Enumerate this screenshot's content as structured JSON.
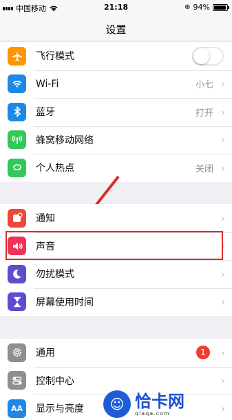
{
  "status_bar": {
    "carrier": "中国移动",
    "time": "21:18",
    "battery": "94%",
    "battery_level": 0.94
  },
  "nav": {
    "title": "设置"
  },
  "groups": [
    {
      "rows": [
        {
          "label": "飞行模式",
          "icon": "airplane-icon",
          "color": "#ff9500",
          "toggle": false
        },
        {
          "label": "Wi-Fi",
          "icon": "wifi-icon",
          "color": "#1e88e5",
          "value": "小七"
        },
        {
          "label": "蓝牙",
          "icon": "bluetooth-icon",
          "color": "#1e88e5",
          "value": "打开"
        },
        {
          "label": "蜂窝移动网络",
          "icon": "cellular-icon",
          "color": "#34c759"
        },
        {
          "label": "个人热点",
          "icon": "hotspot-icon",
          "color": "#34c759",
          "value": "关闭"
        }
      ]
    },
    {
      "rows": [
        {
          "label": "通知",
          "icon": "notification-icon",
          "color": "#f0453a"
        },
        {
          "label": "声音",
          "icon": "sound-icon",
          "color": "#f0315a"
        },
        {
          "label": "勿扰模式",
          "icon": "moon-icon",
          "color": "#5c4ecf"
        },
        {
          "label": "屏幕使用时间",
          "icon": "hourglass-icon",
          "color": "#5c4ecf"
        }
      ]
    },
    {
      "rows": [
        {
          "label": "通用",
          "icon": "gear-icon",
          "color": "#8e8e93",
          "badge": "1"
        },
        {
          "label": "控制中心",
          "icon": "switches-icon",
          "color": "#8e8e93"
        },
        {
          "label": "显示与亮度",
          "icon": "text-size-icon",
          "color": "#1e88e5"
        }
      ]
    }
  ],
  "watermark": {
    "title": "恰卡网",
    "url": "qiaqa.com"
  }
}
